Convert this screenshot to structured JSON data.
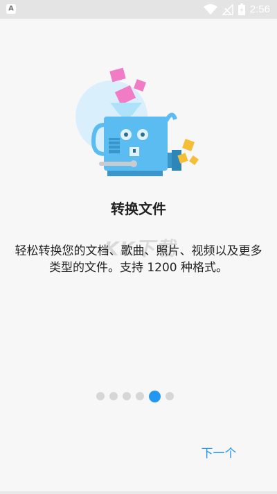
{
  "status_bar": {
    "time": "2:56",
    "icons": [
      "app-badge-icon",
      "wifi-icon",
      "signal-off-icon",
      "battery-icon"
    ]
  },
  "onboarding": {
    "illustration": "file-converter-machine-illustration",
    "title": "转换文件",
    "description": "轻松转换您的文档、歌曲、照片、视频以及更多类型的文件。支持 1200 种格式。",
    "watermark": "KK下载",
    "page_count": 6,
    "active_page": 5,
    "next_label": "下一个"
  },
  "colors": {
    "accent": "#2196f3",
    "machine_blue": "#5bbcf2",
    "pink_box": "#f07cc5",
    "yellow_box": "#f5be38",
    "halo": "#d9effb"
  }
}
